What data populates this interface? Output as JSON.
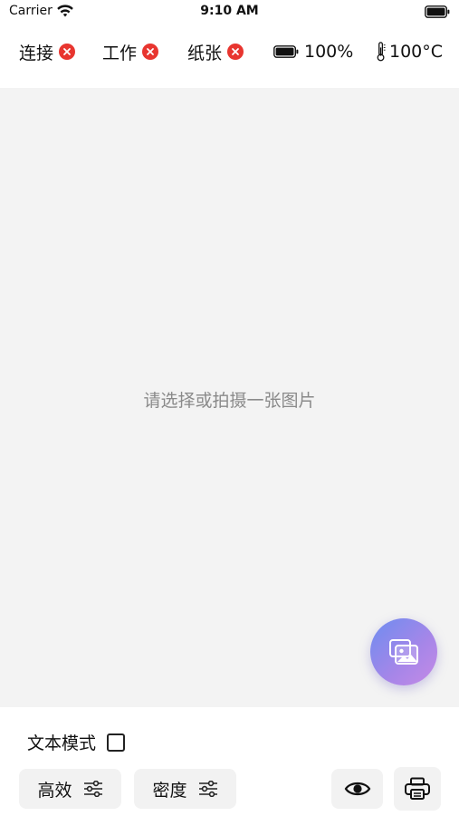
{
  "status_bar": {
    "carrier": "Carrier",
    "time": "9:10 AM",
    "icons": [
      "wifi-icon",
      "battery-icon"
    ]
  },
  "device_status": {
    "connection_label": "连接",
    "work_label": "工作",
    "paper_label": "纸张",
    "battery": "100%",
    "temperature": "100°C",
    "error_color": "#e8352f"
  },
  "preview": {
    "placeholder": "请选择或拍摄一张图片",
    "fab_icon": "image-gallery-icon"
  },
  "controls": {
    "text_mode_label": "文本模式",
    "efficiency_label": "高效",
    "density_label": "密度",
    "settings_icon": "sliders-icon",
    "preview_icon": "eye-icon",
    "print_icon": "printer-icon"
  },
  "colors": {
    "accent_gradient": [
      "#6d8df0",
      "#c58ae6"
    ],
    "button_bg": "#f2f2f2",
    "preview_bg": "#f3f3f3"
  }
}
